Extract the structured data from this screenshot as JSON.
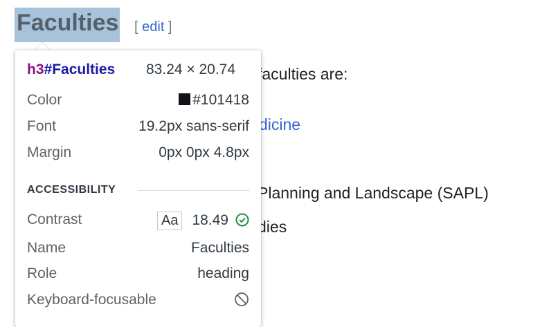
{
  "heading": {
    "text": "Faculties",
    "edit_open": "[ ",
    "edit_link": "edit",
    "edit_close": " ]"
  },
  "body": {
    "line1": "faculties are:",
    "line2_link": "dicine",
    "line3": "Planning and Landscape (SAPL)",
    "line4": "dies"
  },
  "tooltip": {
    "tag": "h3",
    "id": "#Faculties",
    "dimensions": "83.24 × 20.74",
    "rows": [
      {
        "label": "Color",
        "value": "#101418"
      },
      {
        "label": "Font",
        "value": "19.2px sans-serif"
      },
      {
        "label": "Margin",
        "value": "0px 0px 4.8px"
      }
    ],
    "section_title": "ACCESSIBILITY",
    "accessibility": {
      "contrast_label": "Contrast",
      "contrast_sample": "Aa",
      "contrast_value": "18.49",
      "name_label": "Name",
      "name_value": "Faculties",
      "role_label": "Role",
      "role_value": "heading",
      "focusable_label": "Keyboard-focusable"
    },
    "icons": {
      "contrast_ok": "check-circle-icon",
      "not_focusable": "no-entry-icon"
    },
    "colors": {
      "swatch": "#101418",
      "ok": "#1e8e3e",
      "tag": "#881280",
      "id": "#1a1aa6"
    }
  }
}
